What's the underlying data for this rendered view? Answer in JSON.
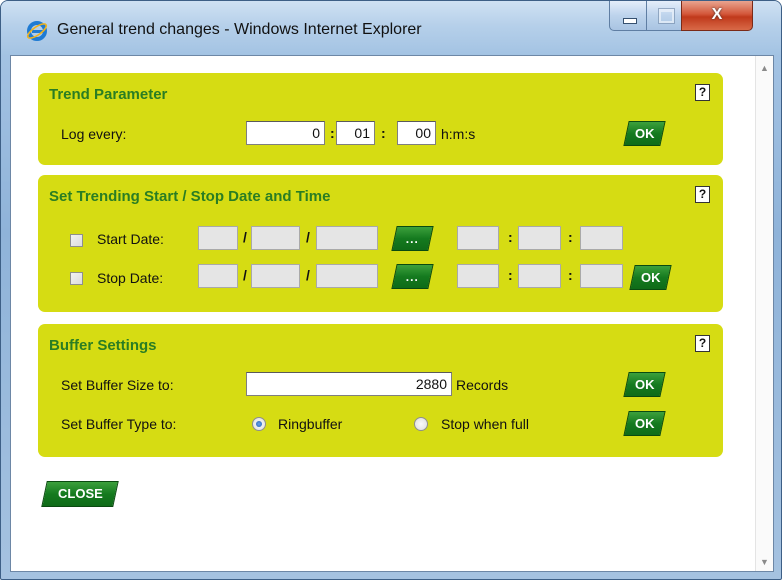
{
  "window": {
    "title": "General trend changes - Windows Internet Explorer",
    "close_glyph": "X"
  },
  "trend_parameter": {
    "title": "Trend Parameter",
    "help": "?",
    "log_every_label": "Log every:",
    "hours": "0",
    "minutes": "01",
    "seconds": "00",
    "sep1": ":",
    "sep2": ":",
    "unit": "h:m:s",
    "ok_label": "OK"
  },
  "start_stop": {
    "title": "Set Trending Start / Stop Date and Time",
    "help": "?",
    "start_label": "Start Date:",
    "stop_label": "Stop Date:",
    "date_sep": "/",
    "time_sep": ":",
    "picker_label": "...",
    "ok_label": "OK"
  },
  "buffer": {
    "title": "Buffer Settings",
    "help": "?",
    "size_label": "Set Buffer Size to:",
    "size_value": "2880",
    "size_unit": "Records",
    "type_label": "Set Buffer Type to:",
    "option_ring": "Ringbuffer",
    "option_stop": "Stop when full",
    "selected": "Ringbuffer",
    "ok_label": "OK"
  },
  "close_label": "CLOSE",
  "colors": {
    "panel_bg": "#d6dc13",
    "panel_title": "#2a7d23",
    "button_green": "#157a1f"
  }
}
